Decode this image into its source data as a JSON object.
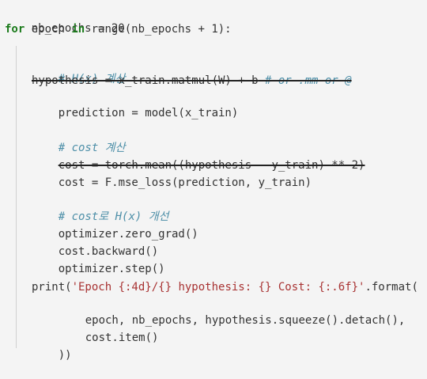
{
  "code": {
    "l1": "nb_epochs = 20",
    "l2_for": "for",
    "l2_a": " epoch ",
    "l2_in": "in",
    "l2_b": " range(nb_epochs + 1):",
    "c1": "# H(x) 계산",
    "h_strike": "hypothesis = x_train.matmul(W) + b",
    "h_comment": " # or .mm or @",
    "pred": "prediction = model(x_train)",
    "c2": "# cost 계산",
    "cost_strike": "cost = torch.mean((hypothesis - y_train) ** 2)",
    "cost_line": "cost = F.mse_loss(prediction, y_train)",
    "c3": "# cost로 H(x) 개선",
    "opt1": "optimizer.zero_grad()",
    "opt2": "cost.backward()",
    "opt3": "optimizer.step()",
    "print_a": "print(",
    "print_str": "'Epoch {:4d}/{} hypothesis: {} Cost: {:.6f}'",
    "print_b": ".format(",
    "arg1": "epoch, nb_epochs, hypothesis.squeeze().detach(),",
    "arg2": "cost.item()",
    "close": "))"
  }
}
